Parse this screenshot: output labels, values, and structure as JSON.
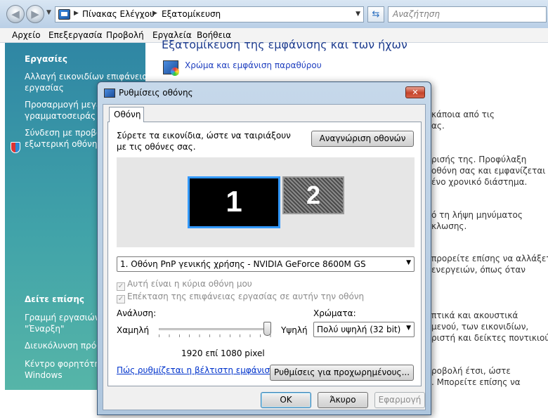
{
  "addressbar": {
    "crumbs": [
      "Πίνακας Ελέγχου",
      "Εξατομίκευση"
    ],
    "search_placeholder": "Αναζήτηση"
  },
  "menubar": [
    "Αρχείο",
    "Επεξεργασία",
    "Προβολή",
    "Εργαλεία",
    "Βοήθεια"
  ],
  "sidebar": {
    "tasks_heading": "Εργασίες",
    "tasks": [
      "Αλλαγή εικονιδίων επιφάνειας\nεργασίας",
      "Προσαρμογή μεγέθ\nγραμματοσειράς (D",
      "Σύνδεση με προβολ\nεξωτερική οθόνη"
    ],
    "see_also_heading": "Δείτε επίσης",
    "see_also": [
      "Γραμμή εργασιών κ\n\"Έναρξη\"",
      "Διευκόλυνση πρόσ",
      "Κέντρο φορητότητ\nWindows"
    ]
  },
  "content": {
    "title": "Εξατομίκευση της εμφάνισης και των ήχων",
    "link": "Χρώμα και εμφάνιση παραθύρου",
    "fragments": [
      "κάποια από τις\nας.",
      "ρισής της. Προφύλαξη\nοθόνη σας και εμφανίζεται\nένο χρονικό διάστημα.",
      "ό τη λήψη μηνύματος\nκλωσης.",
      "προρείτε επίσης να αλλάξετε\nενεργειών, όπως όταν",
      "πτικά και ακουστικά\nμενού, των εικονιδίων,\nριστή και δείκτες ποντικιού.",
      "ροβολή έτσι, ώστε\n. Μπορείτε επίσης να"
    ]
  },
  "dialog": {
    "title": "Ρυθμίσεις οθόνης",
    "tab": "Οθόνη",
    "instructions": "Σύρετε τα εικονίδια, ώστε να ταιριάξουν με τις οθόνες σας.",
    "identify_button": "Αναγνώριση οθονών",
    "monitors": [
      "1",
      "2"
    ],
    "monitor_select": "1. Οθόνη PnP γενικής χρήσης - NVIDIA GeForce 8600M GS",
    "checkbox_primary": "Αυτή είναι η κύρια οθόνη μου",
    "checkbox_extend": "Επέκταση της επιφάνειας εργασίας σε αυτήν την οθόνη",
    "resolution_label": "Ανάλυση:",
    "resolution_low": "Χαμηλή",
    "resolution_high": "Υψηλή",
    "resolution_level": 1.0,
    "resolution_value": "1920 επί 1080 pixel",
    "colors_label": "Χρώματα:",
    "colors_value": "Πολύ υψηλή (32 bit)",
    "help_link": "Πώς ρυθμίζεται η βέλτιστη εμφάνιση;",
    "advanced_button": "Ρυθμίσεις για προχωρημένους...",
    "ok": "ΟΚ",
    "cancel": "Άκυρο",
    "apply": "Εφαρμογή"
  }
}
